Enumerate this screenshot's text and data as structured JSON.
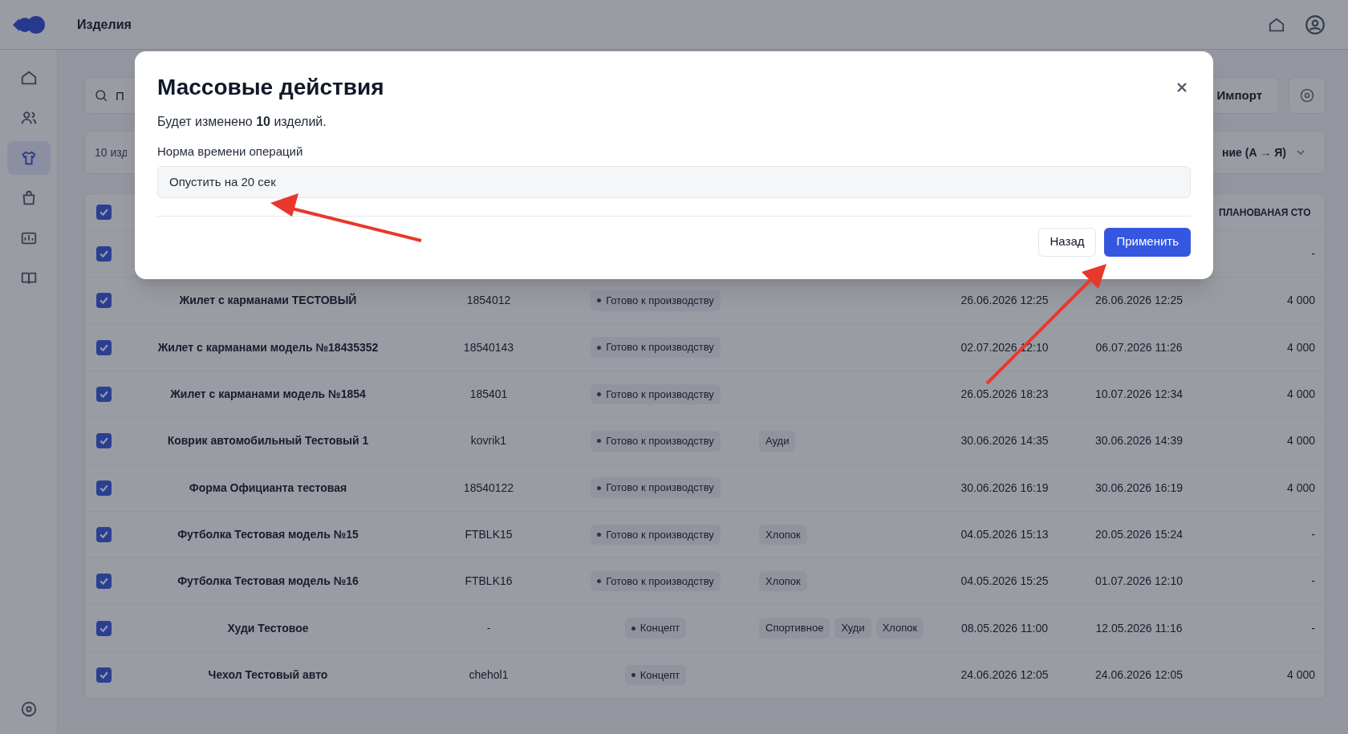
{
  "header": {
    "title": "Изделия"
  },
  "sidebar": {
    "items": [
      {
        "kind": "home",
        "selected": false
      },
      {
        "kind": "users",
        "selected": false
      },
      {
        "kind": "shirt",
        "selected": true
      },
      {
        "kind": "bag",
        "selected": false
      },
      {
        "kind": "chart",
        "selected": false
      },
      {
        "kind": "book",
        "selected": false
      }
    ]
  },
  "toolbar": {
    "search_placeholder": "П",
    "import_button": "Импорт",
    "count": "10 изд",
    "sort": "ние (А → Я)"
  },
  "table": {
    "header_checked": true,
    "visible_heading": "ПЛАНОВАНАЯ СТО",
    "rows": [
      {
        "checked": true,
        "price": "-"
      },
      {
        "checked": true,
        "name": "Жилет с карманами ТЕСТОВЫЙ",
        "article": "1854012",
        "status": "Готово к производству",
        "tags": [],
        "created": "26.06.2026 12:25",
        "updated": "26.06.2026 12:25",
        "price": "4 000"
      },
      {
        "checked": true,
        "name": "Жилет с карманами модель №18435352",
        "article": "18540143",
        "status": "Готово к производству",
        "tags": [],
        "created": "02.07.2026 12:10",
        "updated": "06.07.2026 11:26",
        "price": "4 000"
      },
      {
        "checked": true,
        "name": "Жилет с карманами модель №1854",
        "article": "185401",
        "status": "Готово к производству",
        "tags": [],
        "created": "26.05.2026 18:23",
        "updated": "10.07.2026 12:34",
        "price": "4 000"
      },
      {
        "checked": true,
        "name": "Коврик автомобильный Тестовый 1",
        "article": "kovrik1",
        "status": "Готово к производству",
        "tags": [
          "Ауди"
        ],
        "created": "30.06.2026 14:35",
        "updated": "30.06.2026 14:39",
        "price": "4 000"
      },
      {
        "checked": true,
        "name": "Форма Официанта тестовая",
        "article": "18540122",
        "status": "Готово к производству",
        "tags": [],
        "created": "30.06.2026 16:19",
        "updated": "30.06.2026 16:19",
        "price": "4 000"
      },
      {
        "checked": true,
        "name": "Футболка Тестовая модель №15",
        "article": "FTBLK15",
        "status": "Готово к производству",
        "tags": [
          "Хлопок"
        ],
        "created": "04.05.2026 15:13",
        "updated": "20.05.2026 15:24",
        "price": "-"
      },
      {
        "checked": true,
        "name": "Футболка Тестовая модель №16",
        "article": "FTBLK16",
        "status": "Готово к производству",
        "tags": [
          "Хлопок"
        ],
        "created": "04.05.2026 15:25",
        "updated": "01.07.2026 12:10",
        "price": "-"
      },
      {
        "checked": true,
        "name": "Худи Тестовое",
        "article": "-",
        "status": "Концепт",
        "tags": [
          "Спортивное",
          "Худи",
          "Хлопок"
        ],
        "created": "08.05.2026 11:00",
        "updated": "12.05.2026 11:16",
        "price": "-"
      },
      {
        "checked": true,
        "name": "Чехол Тестовый авто",
        "article": "chehol1",
        "status": "Концепт",
        "tags": [],
        "created": "24.06.2026 12:05",
        "updated": "24.06.2026 12:05",
        "price": "4 000"
      }
    ]
  },
  "modal": {
    "title": "Массовые действия",
    "summary": "Будет изменено **10** изделий.",
    "field_label": "Норма времени операций",
    "field_value": "Опустить на 20 сек",
    "buttons": [
      {
        "label": "Назад",
        "kind": "secondary"
      },
      {
        "label": "Применить",
        "kind": "primary"
      }
    ]
  }
}
